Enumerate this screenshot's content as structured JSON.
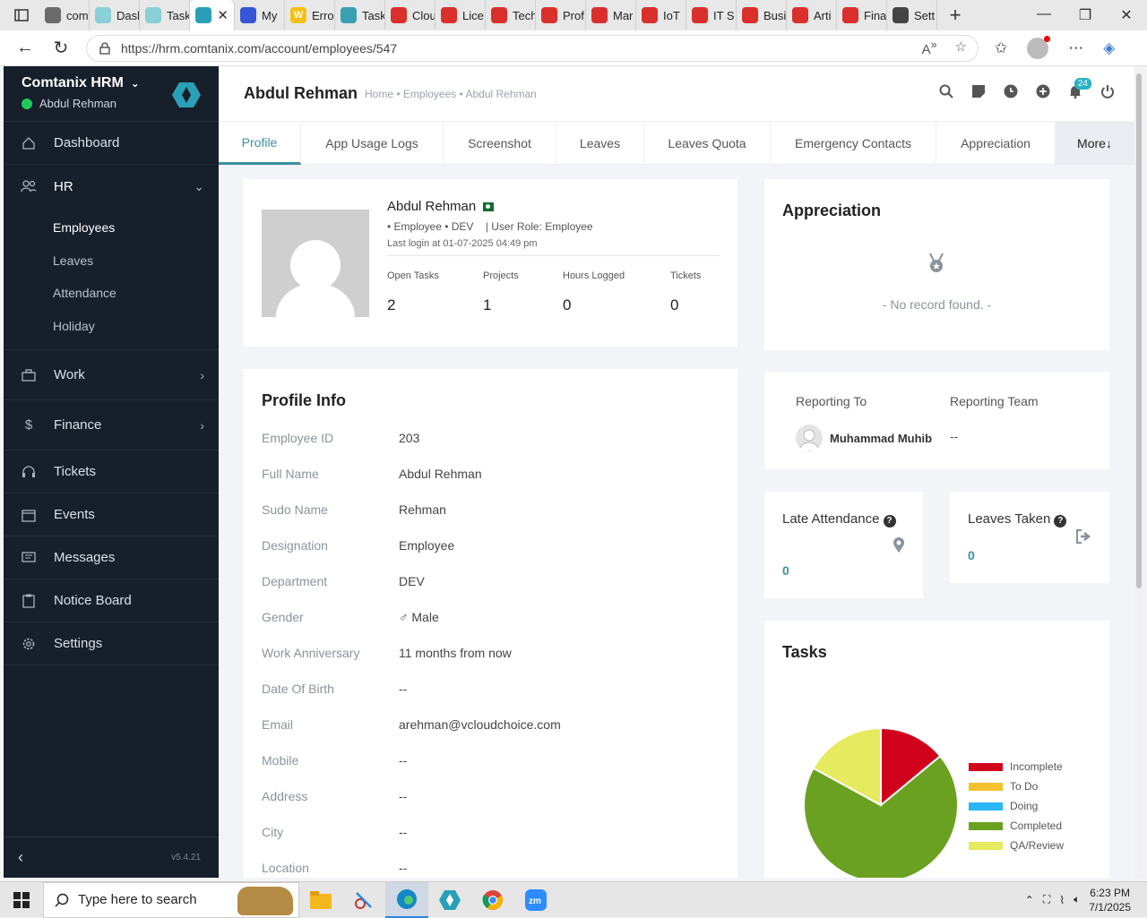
{
  "browser": {
    "tabs": [
      {
        "label": "com",
        "fav": "globe-icon",
        "color": "#6b6b6b"
      },
      {
        "label": "Dasl",
        "fav": "app-icon",
        "color": "#8ad0d8"
      },
      {
        "label": "Task",
        "fav": "app-icon",
        "color": "#8ad0d8"
      },
      {
        "label": "",
        "fav": "app-icon",
        "color": "#2aa0b8",
        "active": true
      },
      {
        "label": "My",
        "fav": "forms-icon",
        "color": "#3557d6"
      },
      {
        "label": "Erro",
        "fav": "w-icon",
        "color": "#f3c114"
      },
      {
        "label": "Task",
        "fav": "app-icon",
        "color": "#3a9fb0"
      },
      {
        "label": "Clou",
        "fav": "red-logo-icon",
        "color": "#d9302b"
      },
      {
        "label": "Lice",
        "fav": "red-logo-icon",
        "color": "#d9302b"
      },
      {
        "label": "Tech",
        "fav": "red-logo-icon",
        "color": "#d9302b"
      },
      {
        "label": "Prof",
        "fav": "red-logo-icon",
        "color": "#d9302b"
      },
      {
        "label": "Mar",
        "fav": "red-logo-icon",
        "color": "#d9302b"
      },
      {
        "label": "IoT",
        "fav": "red-logo-icon",
        "color": "#d9302b"
      },
      {
        "label": "IT S",
        "fav": "red-logo-icon",
        "color": "#d9302b"
      },
      {
        "label": "Busi",
        "fav": "red-logo-icon",
        "color": "#d9302b"
      },
      {
        "label": "Arti",
        "fav": "red-logo-icon",
        "color": "#d9302b"
      },
      {
        "label": "Fina",
        "fav": "red-logo-icon",
        "color": "#d9302b"
      },
      {
        "label": "Sett",
        "fav": "gear-icon",
        "color": "#444444"
      }
    ],
    "url": "https://hrm.comtanix.com/account/employees/547"
  },
  "sidebar": {
    "company": "Comtanix HRM",
    "user": "Abdul Rehman",
    "items": [
      {
        "label": "Dashboard",
        "icon": "home-icon"
      },
      {
        "label": "HR",
        "icon": "users-icon"
      },
      {
        "label": "Work",
        "icon": "briefcase-icon"
      },
      {
        "label": "Finance",
        "icon": "dollar-icon"
      },
      {
        "label": "Tickets",
        "icon": "headset-icon"
      },
      {
        "label": "Events",
        "icon": "calendar-icon"
      },
      {
        "label": "Messages",
        "icon": "message-icon"
      },
      {
        "label": "Notice Board",
        "icon": "clipboard-icon"
      },
      {
        "label": "Settings",
        "icon": "gear-icon"
      }
    ],
    "hr_sub": [
      "Employees",
      "Leaves",
      "Attendance",
      "Holiday"
    ],
    "version": "v5.4.21"
  },
  "header": {
    "title": "Abdul Rehman",
    "breadcrumb": "Home • Employees • Abdul Rehman",
    "notif_count": "24"
  },
  "tabs": [
    "Profile",
    "App Usage Logs",
    "Screenshot",
    "Leaves",
    "Leaves Quota",
    "Emergency Contacts",
    "Appreciation",
    "More↓"
  ],
  "employee": {
    "name": "Abdul Rehman",
    "meta": "• Employee • DEV    | User Role: Employee",
    "last_login": "Last login at 01-07-2025 04:49 pm",
    "stats": [
      {
        "label": "Open Tasks",
        "value": "2"
      },
      {
        "label": "Projects",
        "value": "1"
      },
      {
        "label": "Hours Logged",
        "value": "0"
      },
      {
        "label": "Tickets",
        "value": "0"
      }
    ]
  },
  "profile_info": {
    "title": "Profile Info",
    "rows": [
      {
        "k": "Employee ID",
        "v": "203"
      },
      {
        "k": "Full Name",
        "v": "Abdul Rehman"
      },
      {
        "k": "Sudo Name",
        "v": "Rehman"
      },
      {
        "k": "Designation",
        "v": "Employee"
      },
      {
        "k": "Department",
        "v": "DEV"
      },
      {
        "k": "Gender",
        "v": "♂ Male"
      },
      {
        "k": "Work Anniversary",
        "v": "11 months from now"
      },
      {
        "k": "Date Of Birth",
        "v": "--"
      },
      {
        "k": "Email",
        "v": "arehman@vcloudchoice.com"
      },
      {
        "k": "Mobile",
        "v": "--"
      },
      {
        "k": "Address",
        "v": "--"
      },
      {
        "k": "City",
        "v": "--"
      },
      {
        "k": "Location",
        "v": "--"
      }
    ]
  },
  "appreciation": {
    "title": "Appreciation",
    "empty": "- No record found. -"
  },
  "reporting": {
    "to_label": "Reporting To",
    "to_name": "Muhammad Muhib",
    "team_label": "Reporting Team",
    "team_value": "--"
  },
  "late_attendance": {
    "label": "Late Attendance",
    "value": "0"
  },
  "leaves_taken": {
    "label": "Leaves Taken",
    "value": "0"
  },
  "tasks": {
    "title": "Tasks"
  },
  "chart_data": {
    "type": "pie",
    "series": [
      {
        "name": "Incomplete",
        "value": 14,
        "color": "#d0021b"
      },
      {
        "name": "To Do",
        "value": 0,
        "color": "#f5c130"
      },
      {
        "name": "Doing",
        "value": 0,
        "color": "#29b6f6"
      },
      {
        "name": "Completed",
        "value": 69,
        "color": "#6aa121"
      },
      {
        "name": "QA/Review",
        "value": 17,
        "color": "#e6ea5e"
      }
    ]
  },
  "taskbar": {
    "search_placeholder": "Type here to search",
    "time": "6:23 PM",
    "date": "7/1/2025"
  }
}
